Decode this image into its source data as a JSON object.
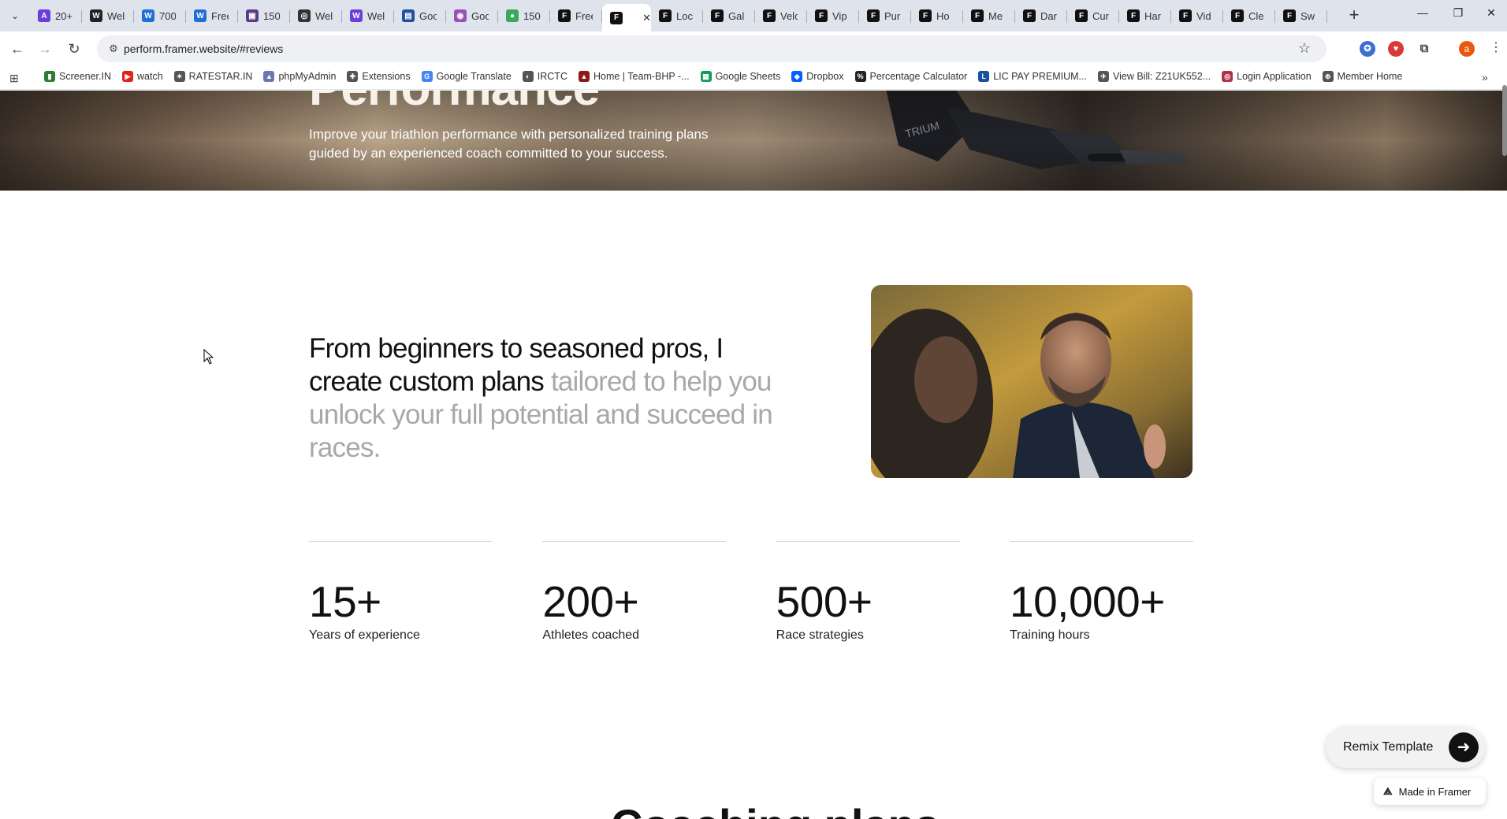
{
  "browser": {
    "tabs": [
      {
        "label": "20+",
        "icon": "A",
        "color": "#6b3fd6"
      },
      {
        "label": "Wel",
        "icon": "W",
        "color": "#222222"
      },
      {
        "label": "700",
        "icon": "W",
        "color": "#1f6fd6"
      },
      {
        "label": "Free",
        "icon": "W",
        "color": "#1f6fd6"
      },
      {
        "label": "150",
        "icon": "▣",
        "color": "#5a3b8a"
      },
      {
        "label": "Wel",
        "icon": "◎",
        "color": "#333333"
      },
      {
        "label": "Wel",
        "icon": "W",
        "color": "#6b3fd6"
      },
      {
        "label": "Goo",
        "icon": "▤",
        "color": "#1f4fa0"
      },
      {
        "label": "Goo",
        "icon": "◉",
        "color": "#9b4fb8"
      },
      {
        "label": "150",
        "icon": "●",
        "color": "#3aa85a"
      },
      {
        "label": "Free",
        "icon": "F",
        "color": "#111111"
      },
      {
        "label": "",
        "icon": "F",
        "color": "#111111",
        "active": true
      },
      {
        "label": "Loc",
        "icon": "F",
        "color": "#111111"
      },
      {
        "label": "Gal",
        "icon": "F",
        "color": "#111111"
      },
      {
        "label": "Velo",
        "icon": "F",
        "color": "#111111"
      },
      {
        "label": "Vip",
        "icon": "F",
        "color": "#111111"
      },
      {
        "label": "Pur",
        "icon": "F",
        "color": "#111111"
      },
      {
        "label": "Ho",
        "icon": "F",
        "color": "#111111"
      },
      {
        "label": "Me",
        "icon": "F",
        "color": "#111111"
      },
      {
        "label": "Dar",
        "icon": "F",
        "color": "#111111"
      },
      {
        "label": "Cur",
        "icon": "F",
        "color": "#111111"
      },
      {
        "label": "Har",
        "icon": "F",
        "color": "#111111"
      },
      {
        "label": "Vid",
        "icon": "F",
        "color": "#111111"
      },
      {
        "label": "Cle",
        "icon": "F",
        "color": "#111111"
      },
      {
        "label": "Sw",
        "icon": "F",
        "color": "#111111"
      }
    ],
    "url": "perform.framer.website/#reviews",
    "profile_initial": "a",
    "bookmarks": [
      {
        "label": "Screener.IN",
        "icon": "▮",
        "color": "#2e7d32"
      },
      {
        "label": "watch",
        "icon": "▶",
        "color": "#e62117"
      },
      {
        "label": "RATESTAR.IN",
        "icon": "✶",
        "color": "#555555"
      },
      {
        "label": "phpMyAdmin",
        "icon": "▲",
        "color": "#6c78af"
      },
      {
        "label": "Extensions",
        "icon": "✚",
        "color": "#555555"
      },
      {
        "label": "Google Translate",
        "icon": "G",
        "color": "#4285f4"
      },
      {
        "label": "IRCTC",
        "icon": "◐",
        "color": "#555555"
      },
      {
        "label": "Home | Team-BHP -...",
        "icon": "▲",
        "color": "#8b1a1a"
      },
      {
        "label": "Google Sheets",
        "icon": "▦",
        "color": "#0f9d58"
      },
      {
        "label": "Dropbox",
        "icon": "◆",
        "color": "#0061fe"
      },
      {
        "label": "Percentage Calculator",
        "icon": "%",
        "color": "#222222"
      },
      {
        "label": "LIC PAY PREMIUM...",
        "icon": "L",
        "color": "#1a4f9c"
      },
      {
        "label": "View Bill: Z21UK552...",
        "icon": "✈",
        "color": "#555555"
      },
      {
        "label": "Login Application",
        "icon": "◎",
        "color": "#b0324a"
      },
      {
        "label": "Member Home",
        "icon": "⊕",
        "color": "#555555"
      }
    ]
  },
  "hero": {
    "title_partial": "Performance",
    "subtitle": "Improve your triathlon performance with personalized training plans guided by an experienced coach committed to your success."
  },
  "intro": {
    "strong": "From beginners to seasoned pros, I create custom plans",
    "muted": " tailored to help you unlock your full potential and succeed in races."
  },
  "stats": [
    {
      "value": "15+",
      "label": "Years of experience"
    },
    {
      "value": "200+",
      "label": "Athletes coached"
    },
    {
      "value": "500+",
      "label": "Race strategies"
    },
    {
      "value": "10,000+",
      "label": "Training hours"
    }
  ],
  "next_section_heading_partial": "Coaching plans",
  "floating": {
    "remix_label": "Remix Template",
    "framer_badge": "Made in Framer"
  }
}
